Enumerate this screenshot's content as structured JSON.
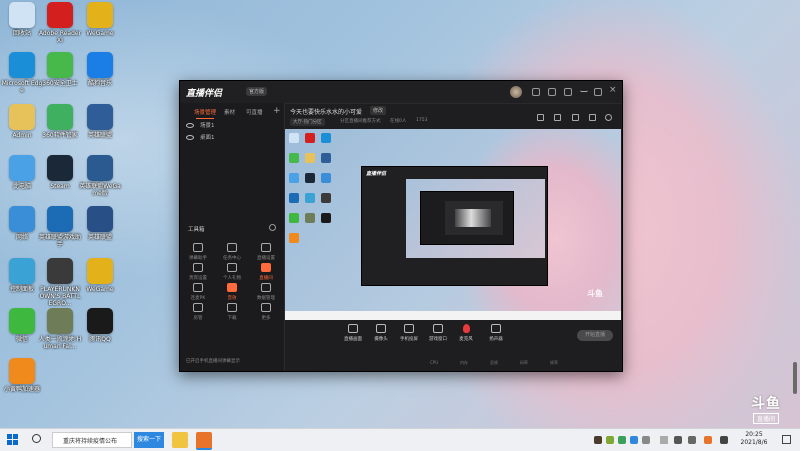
{
  "desktop": {
    "icons": [
      {
        "label": "回收站",
        "icon": "recycle-bin-icon",
        "color": "#cfe3f5"
      },
      {
        "label": "Adobe Reader XI",
        "icon": "adobe-reader-icon",
        "color": "#d41f1f"
      },
      {
        "label": "WeGame",
        "icon": "wegame-icon",
        "color": "#e3b21a"
      },
      {
        "label": "Microsoft Edge",
        "icon": "edge-icon",
        "color": "#1a8fd8"
      },
      {
        "label": "360安全卫士",
        "icon": "360-icon",
        "color": "#47b84a"
      },
      {
        "label": "酷狗音乐",
        "icon": "kugou-icon",
        "color": "#1a7ee6"
      },
      {
        "label": "Admin",
        "icon": "user-folder-icon",
        "color": "#e7c15a"
      },
      {
        "label": "360软件管家",
        "icon": "360-store-icon",
        "color": "#3fb060"
      },
      {
        "label": "英雄联盟",
        "icon": "lol-icon",
        "color": "#2f5d98"
      },
      {
        "label": "此电脑",
        "icon": "computer-icon",
        "color": "#4aa1e6"
      },
      {
        "label": "Steam",
        "icon": "steam-icon",
        "color": "#1b2838"
      },
      {
        "label": "英雄联盟WeGame版",
        "icon": "lol-wegame-icon",
        "color": "#2b5a91"
      },
      {
        "label": "网络",
        "icon": "network-icon",
        "color": "#3a8ed8"
      },
      {
        "label": "英雄联盟游戏助手",
        "icon": "lol-helper-icon",
        "color": "#1c6bb5"
      },
      {
        "label": "英雄联盟",
        "icon": "lol-icon",
        "color": "#284f86"
      },
      {
        "label": "控制面板",
        "icon": "control-panel-icon",
        "color": "#3ba2d6"
      },
      {
        "label": "PLAYERUNKNOWN'S BATTLEGRO...",
        "icon": "pubg-icon",
        "color": "#3a3a3a"
      },
      {
        "label": "WeGame",
        "icon": "wegame-icon",
        "color": "#e3b21a"
      },
      {
        "label": "微信",
        "icon": "wechat-icon",
        "color": "#3fb83f"
      },
      {
        "label": "人类一败涂地 Human Fal...",
        "icon": "human-fall-flat-icon",
        "color": "#6e7d58"
      },
      {
        "label": "腾讯QQ",
        "icon": "qq-icon",
        "color": "#1a1a1a"
      },
      {
        "label": "小黄鸭加速器",
        "icon": "duck-accelerator-icon",
        "color": "#f18a1c"
      }
    ]
  },
  "app": {
    "logo": "直播伴侣",
    "version": "官方版",
    "tabs": [
      "场景管理",
      "素材",
      "可直播"
    ],
    "scenes": [
      "场景1",
      "桌面1"
    ],
    "tools_title": "工具箱",
    "tools": [
      {
        "label": "弹幕助手",
        "style": "normal"
      },
      {
        "label": "任务中心",
        "style": "normal"
      },
      {
        "label": "直播设置",
        "style": "normal"
      },
      {
        "label": "贵宾设置",
        "style": "normal"
      },
      {
        "label": "个人礼物",
        "style": "normal"
      },
      {
        "label": "直播间",
        "style": "orange"
      },
      {
        "label": "连麦PK",
        "style": "normal"
      },
      {
        "label": "音效",
        "style": "orange"
      },
      {
        "label": "数据管理",
        "style": "normal"
      },
      {
        "label": "房管",
        "style": "normal"
      },
      {
        "label": "下载",
        "style": "normal"
      },
      {
        "label": "更多",
        "style": "normal"
      }
    ],
    "bottom_note": "已开启手机直播间弹幕显示",
    "stream_title": "今天也要快乐水水的小可爱",
    "title_edit": "修改",
    "meta": [
      "大厅-热门分区",
      "分区直播间推荐方式",
      "在线0人",
      "1753"
    ],
    "controls": [
      "直播画面",
      "摄像头",
      "手机投屏",
      "游戏窗口",
      "麦克风",
      "扬声器"
    ],
    "start_live": "开始直播",
    "status": [
      "CPU",
      "内存",
      "丢帧",
      "码率",
      "帧率"
    ]
  },
  "taskbar": {
    "search_placeholder": "重庆将持续疫情公布",
    "search_button": "搜索一下",
    "time": "20:25",
    "date": "2021/8/6"
  },
  "watermark": {
    "brand": "斗鱼",
    "sub": "直播间"
  }
}
